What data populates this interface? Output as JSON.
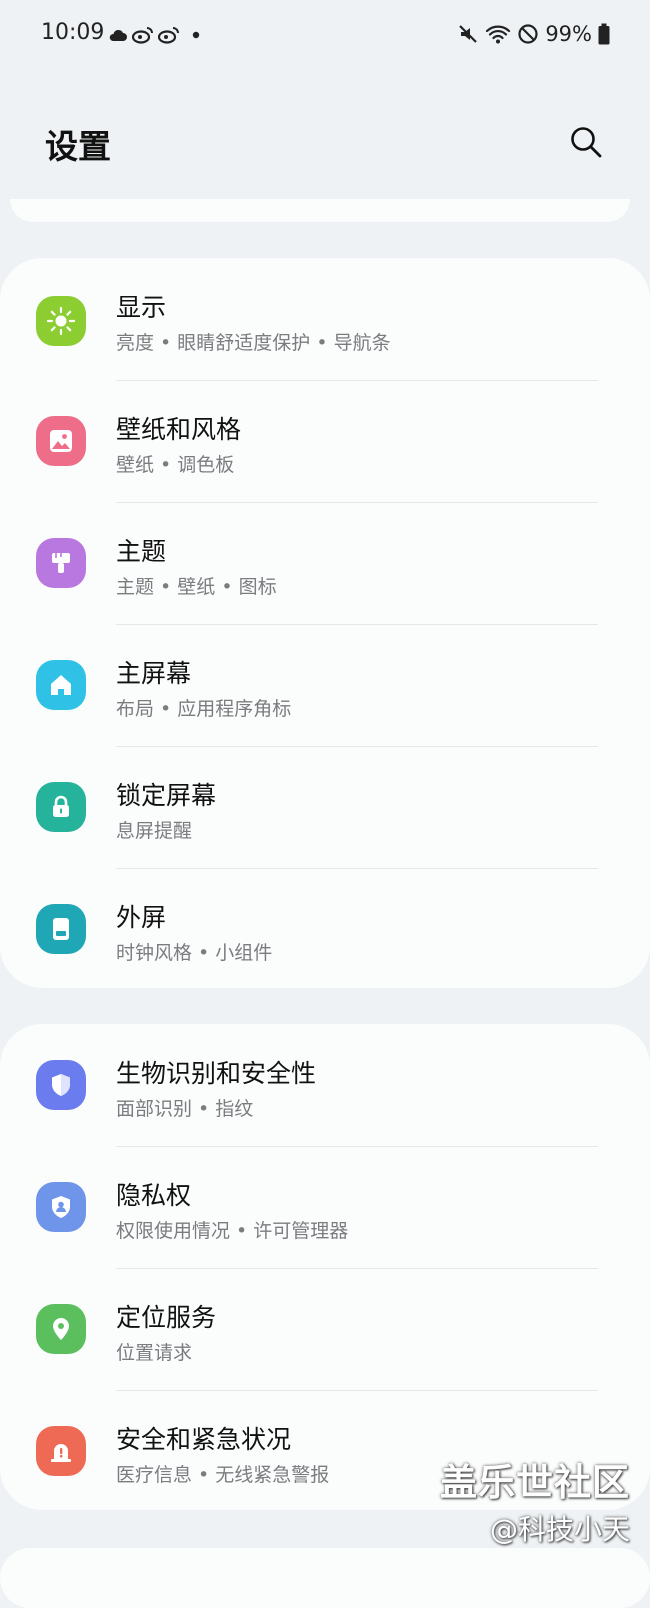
{
  "status_bar": {
    "time": "10:09",
    "battery_text": "99%",
    "left_icons": [
      "cloud-icon",
      "weibo-icon",
      "weibo-icon",
      "dot-icon"
    ],
    "right_icons": [
      "mute-icon",
      "wifi-icon",
      "dnd-icon",
      "battery-icon"
    ]
  },
  "header": {
    "title": "设置",
    "search_icon": "search-icon"
  },
  "groups": [
    {
      "items": [
        {
          "title": "显示",
          "subtitle": "亮度 • 眼睛舒适度保护 • 导航条",
          "icon": "sun-icon",
          "color": "#8ccd32"
        },
        {
          "title": "壁纸和风格",
          "subtitle": "壁纸 • 调色板",
          "icon": "image-icon",
          "color": "#ee6e8a"
        },
        {
          "title": "主题",
          "subtitle": "主题 • 壁纸 • 图标",
          "icon": "paintbrush-icon",
          "color": "#b978e0"
        },
        {
          "title": "主屏幕",
          "subtitle": "布局 • 应用程序角标",
          "icon": "home-icon",
          "color": "#2fc1e6"
        },
        {
          "title": "锁定屏幕",
          "subtitle": "息屏提醒",
          "icon": "lock-icon",
          "color": "#26b39b"
        },
        {
          "title": "外屏",
          "subtitle": "时钟风格 • 小组件",
          "icon": "cover-screen-icon",
          "color": "#1fa7b5"
        }
      ]
    },
    {
      "items": [
        {
          "title": "生物识别和安全性",
          "subtitle": "面部识别 • 指纹",
          "icon": "shield-icon",
          "color": "#6b7cef"
        },
        {
          "title": "隐私权",
          "subtitle": "权限使用情况 • 许可管理器",
          "icon": "privacy-icon",
          "color": "#6e95ea"
        },
        {
          "title": "定位服务",
          "subtitle": "位置请求",
          "icon": "location-pin-icon",
          "color": "#5cbf5d"
        },
        {
          "title": "安全和紧急状况",
          "subtitle": "医疗信息 • 无线紧急警报",
          "icon": "alert-icon",
          "color": "#ee6a55"
        }
      ]
    }
  ],
  "watermark": {
    "line1": "盖乐世社区",
    "line2": "@科技小天"
  }
}
